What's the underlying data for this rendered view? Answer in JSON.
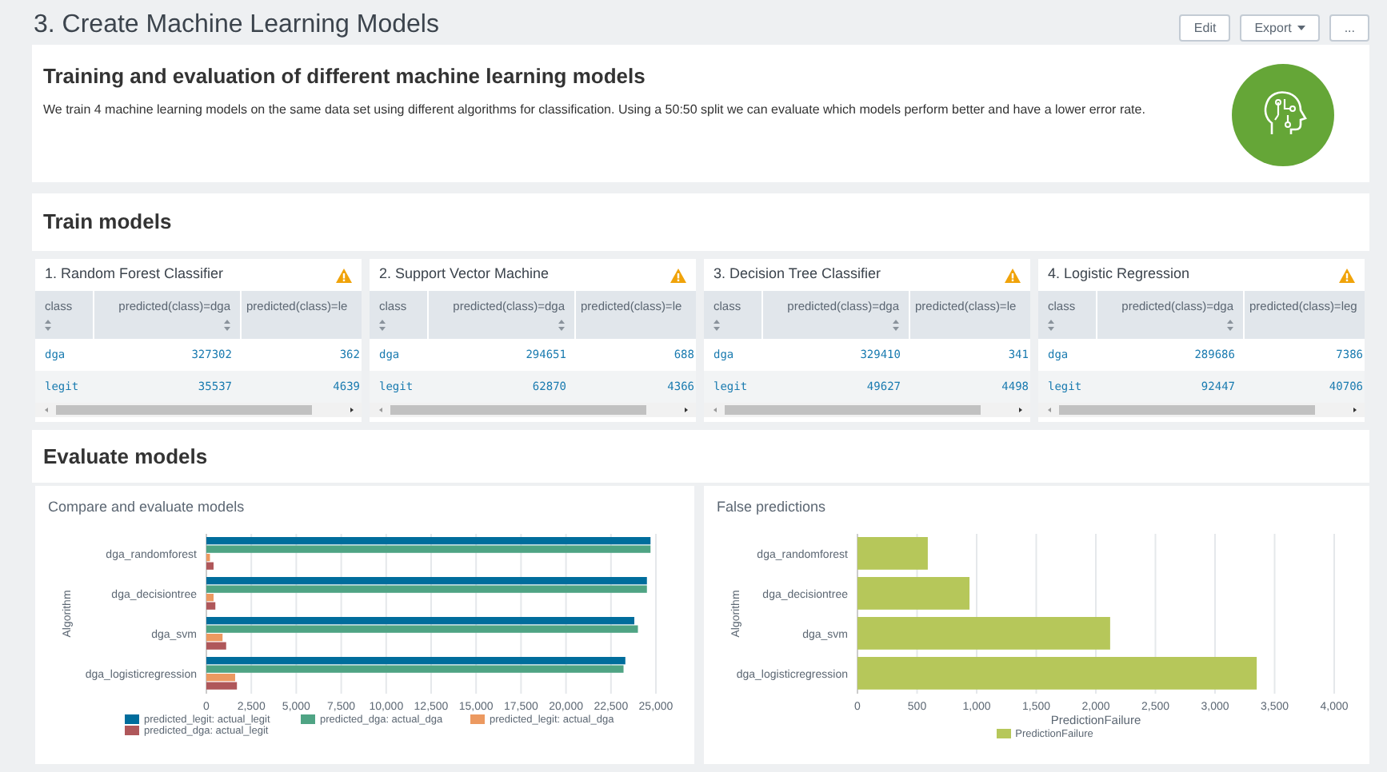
{
  "page_title": "3. Create Machine Learning Models",
  "header_buttons": [
    {
      "label": "Edit",
      "kind": "plain"
    },
    {
      "label": "Export",
      "kind": "dropdown"
    },
    {
      "label": "...",
      "kind": "plain"
    }
  ],
  "intro": {
    "title": "Training and evaluation of different machine learning models",
    "text": "We train 4 machine learning models on the same data set using different algorithms for classification. Using a 50:50 split we can evaluate which models perform better and have a lower error rate."
  },
  "train_section": {
    "title": "Train models"
  },
  "tables": [
    {
      "title": "1. Random Forest Classifier",
      "warning": true,
      "columns": [
        "class",
        "predicted(class)=dga",
        "predicted(class)=le"
      ],
      "rows": [
        [
          "dga",
          "327302",
          "362"
        ],
        [
          "legit",
          "35537",
          "4639"
        ]
      ]
    },
    {
      "title": "2. Support Vector Machine",
      "warning": true,
      "columns": [
        "class",
        "predicted(class)=dga",
        "predicted(class)=le"
      ],
      "rows": [
        [
          "dga",
          "294651",
          "688"
        ],
        [
          "legit",
          "62870",
          "4366"
        ]
      ]
    },
    {
      "title": "3. Decision Tree Classifier",
      "warning": true,
      "columns": [
        "class",
        "predicted(class)=dga",
        "predicted(class)=le"
      ],
      "rows": [
        [
          "dga",
          "329410",
          "341"
        ],
        [
          "legit",
          "49627",
          "4498"
        ]
      ]
    },
    {
      "title": "4. Logistic Regression",
      "warning": true,
      "columns": [
        "class",
        "predicted(class)=dga",
        "predicted(class)=leg"
      ],
      "rows": [
        [
          "dga",
          "289686",
          "7386"
        ],
        [
          "legit",
          "92447",
          "40706"
        ]
      ]
    }
  ],
  "evaluate_section": {
    "title": "Evaluate models"
  },
  "charts": [
    {
      "title": "Compare and evaluate models",
      "chart_data": {
        "type": "bar",
        "orientation": "horizontal",
        "grid": true,
        "ylabel": "Algorithm",
        "categories": [
          "dga_randomforest",
          "dga_decisiontree",
          "dga_svm",
          "dga_logisticregression"
        ],
        "series": [
          {
            "name": "predicted_legit: actual_legit",
            "color": "#006d9c",
            "values": [
              24700,
              24500,
              23800,
              23300
            ]
          },
          {
            "name": "predicted_dga: actual_dga",
            "color": "#4fa484",
            "values": [
              24700,
              24500,
              24000,
              23200
            ]
          },
          {
            "name": "predicted_legit: actual_dga",
            "color": "#ec9960",
            "values": [
              200,
              400,
              900,
              1600
            ]
          },
          {
            "name": "predicted_dga: actual_legit",
            "color": "#af575a",
            "values": [
              400,
              500,
              1100,
              1700
            ]
          }
        ],
        "xlim": [
          0,
          25000
        ],
        "xticks": [
          {
            "value": 0,
            "label": "0"
          },
          {
            "value": 2500,
            "label": "2,500"
          },
          {
            "value": 5000,
            "label": "5,000"
          },
          {
            "value": 7500,
            "label": "7,500"
          },
          {
            "value": 10000,
            "label": "10,000"
          },
          {
            "value": 12500,
            "label": "12,500"
          },
          {
            "value": 15000,
            "label": "15,000"
          },
          {
            "value": 17500,
            "label": "17,500"
          },
          {
            "value": 20000,
            "label": "20,000"
          },
          {
            "value": 22500,
            "label": "22,500"
          },
          {
            "value": 25000,
            "label": "25,000"
          }
        ]
      }
    },
    {
      "title": "False predictions",
      "chart_data": {
        "type": "bar",
        "orientation": "horizontal",
        "grid": true,
        "ylabel": "Algorithm",
        "xlabel": "PredictionFailure",
        "categories": [
          "dga_randomforest",
          "dga_decisiontree",
          "dga_svm",
          "dga_logisticregression"
        ],
        "series": [
          {
            "name": "PredictionFailure",
            "color": "#b6c75a",
            "values": [
              590,
              940,
              2120,
              3350
            ]
          }
        ],
        "xlim": [
          0,
          4000
        ],
        "xticks": [
          {
            "value": 0,
            "label": "0"
          },
          {
            "value": 500,
            "label": "500"
          },
          {
            "value": 1000,
            "label": "1,000"
          },
          {
            "value": 1500,
            "label": "1,500"
          },
          {
            "value": 2000,
            "label": "2,000"
          },
          {
            "value": 2500,
            "label": "2,500"
          },
          {
            "value": 3000,
            "label": "3,000"
          },
          {
            "value": 3500,
            "label": "3,500"
          },
          {
            "value": 4000,
            "label": "4,000"
          }
        ]
      }
    }
  ]
}
